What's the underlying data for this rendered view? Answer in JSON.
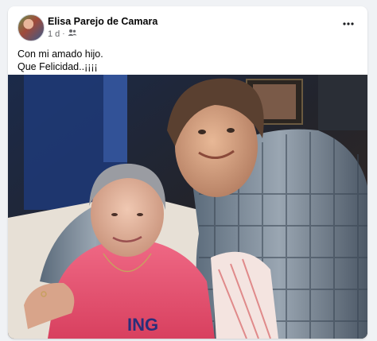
{
  "post": {
    "author": "Elisa Parejo de Camara",
    "time": "1 d",
    "separator": "·",
    "audience_icon": "friends-icon",
    "more_icon": "more-horizontal-icon",
    "text_line1": "Con mi amado hijo.",
    "text_line2": "Que Felicidad..¡¡¡¡",
    "photo_icon": "photo-image"
  },
  "photo": {
    "shirt_text": "ING"
  },
  "colors": {
    "page_bg": "#f0f2f5",
    "card_bg": "#ffffff",
    "name_text": "#050505",
    "meta_text": "#65676b"
  }
}
